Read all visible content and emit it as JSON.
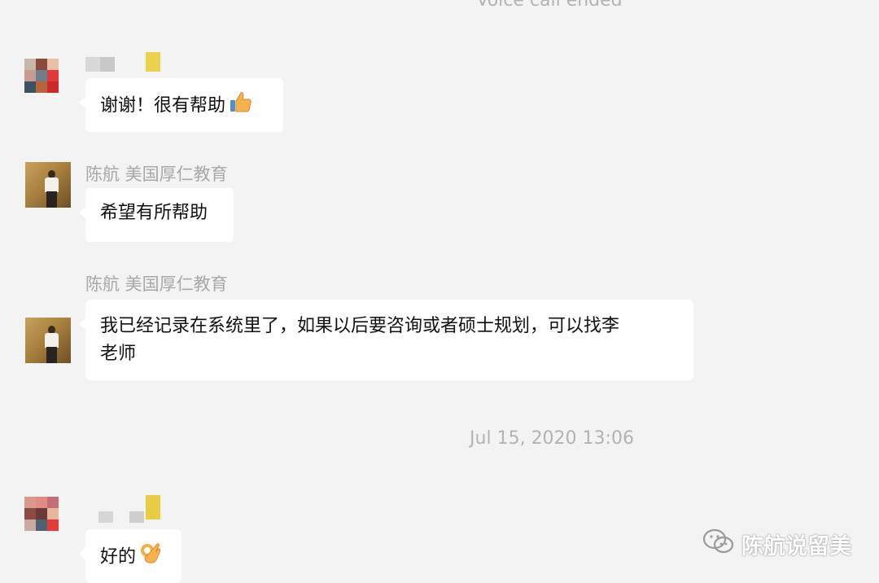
{
  "system": {
    "voice_call": "Voice call ended",
    "timestamp": "Jul 15, 2020 13:06"
  },
  "messages": [
    {
      "sender": "",
      "avatar": "mosaic-avatar",
      "text": "谢谢！很有帮助",
      "emoji": "thumbs-up-icon"
    },
    {
      "sender": "陈航 美国厚仁教育",
      "avatar": "photo-avatar",
      "text": "希望有所帮助"
    },
    {
      "sender": "陈航 美国厚仁教育",
      "avatar": "photo-avatar",
      "text_line1": "我已经记录在系统里了，如果以后要咨询或者硕士规划，可以找李",
      "text_line2": "老师"
    },
    {
      "sender": "",
      "avatar": "mosaic-avatar",
      "text": "好的",
      "emoji": "ok-hand-icon"
    }
  ],
  "watermark": {
    "text": "陈航说留美",
    "icon": "wechat-icon"
  },
  "colors": {
    "background": "#f3f3f3",
    "bubble": "#ffffff",
    "meta": "#a8a8a8"
  }
}
